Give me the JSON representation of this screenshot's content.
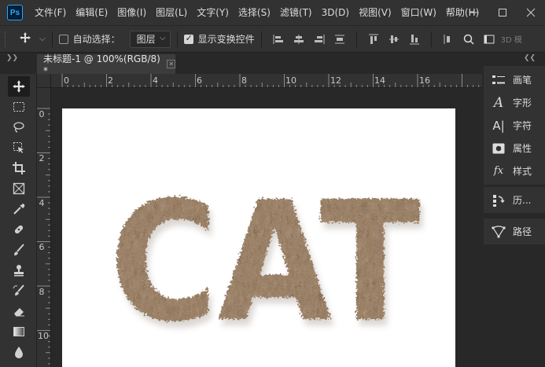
{
  "app": {
    "logo_text": "Ps",
    "accent": "#31a8ff"
  },
  "menu": [
    "文件(F)",
    "编辑(E)",
    "图像(I)",
    "图层(L)",
    "文字(Y)",
    "选择(S)",
    "滤镜(T)",
    "3D(D)",
    "视图(V)",
    "窗口(W)",
    "帮助(H)"
  ],
  "window_controls": {
    "minimize_icon": "minimize-icon",
    "restore_icon": "restore-icon",
    "close_icon": "close-icon"
  },
  "options_bar": {
    "auto_select_label": "自动选择：",
    "auto_select_checked": false,
    "auto_select_target": "图层",
    "show_transform_label": "显示变换控件",
    "show_transform_checked": true,
    "mode_3d_label": "3D 模"
  },
  "document": {
    "tab_title": "未标题-1 @ 100%(RGB/8) *",
    "canvas_text": "CAT"
  },
  "ruler": {
    "h_labels": [
      "0",
      "2",
      "4",
      "6",
      "8",
      "10",
      "12",
      "14",
      "16"
    ],
    "v_labels": [
      "0",
      "2",
      "4",
      "6",
      "8",
      "10"
    ]
  },
  "tools": [
    "move-tool",
    "marquee-tool",
    "lasso-tool",
    "object-select-tool",
    "crop-tool",
    "frame-tool",
    "eyedropper-tool",
    "healing-brush-tool",
    "brush-tool",
    "stamp-tool",
    "history-brush-tool",
    "eraser-tool",
    "gradient-tool",
    "blur-tool",
    "dodge-tool"
  ],
  "right_panel": {
    "group1": [
      {
        "label": "画笔",
        "icon": "brush-panel-icon"
      },
      {
        "label": "字形",
        "icon": "glyphs-icon"
      },
      {
        "label": "字符",
        "icon": "character-icon"
      },
      {
        "label": "属性",
        "icon": "properties-icon"
      },
      {
        "label": "样式",
        "icon": "styles-icon"
      }
    ],
    "group2": [
      {
        "label": "历...",
        "icon": "history-icon"
      }
    ],
    "group3": [
      {
        "label": "路径",
        "icon": "paths-icon"
      }
    ]
  }
}
